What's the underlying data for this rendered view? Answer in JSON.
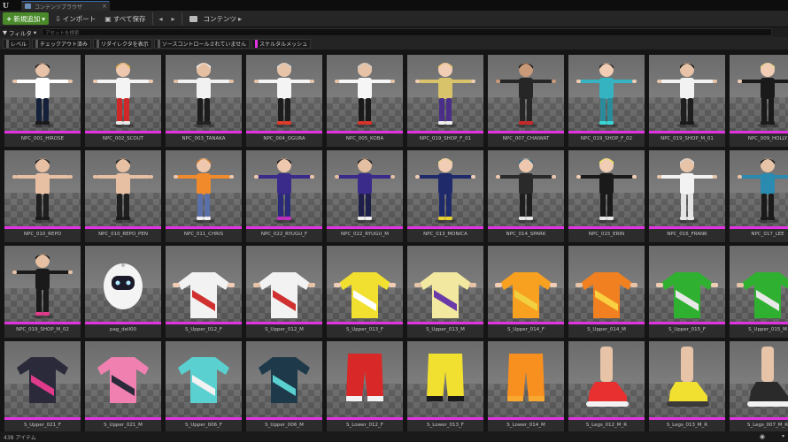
{
  "window": {
    "tab_title": "コンテンツブラウザ"
  },
  "toolbar": {
    "add_new": "新規追加",
    "import": "インポート",
    "save_all": "すべて保存",
    "breadcrumb": "コンテンツ"
  },
  "filter": {
    "filters_label": "フィルタ",
    "search_placeholder": "アセットを検索"
  },
  "chips": [
    {
      "label": "レベル",
      "active": false
    },
    {
      "label": "チェックアウト済み",
      "active": false
    },
    {
      "label": "リダイレクタを表示",
      "active": false
    },
    {
      "label": "ソースコントロールされていません",
      "active": false
    },
    {
      "label": "スケルタルメッシュ",
      "active": true
    }
  ],
  "assets": [
    {
      "name": "NPC_001_HIROSE",
      "kind": "body",
      "top": "#ffffff",
      "bottom": "#15203a",
      "hair": "#1a1a1a",
      "skin": "#e8c3a8",
      "shoes": "#1a1a1a"
    },
    {
      "name": "NPC_002_SCOUT",
      "kind": "body",
      "top": "#f4f4f4",
      "bottom": "#d02828",
      "hair": "#d8a640",
      "skin": "#eec8ae",
      "shoes": "#e8e8e8"
    },
    {
      "name": "NPC_003_TANAKA",
      "kind": "body",
      "top": "#f1f1f1",
      "bottom": "#1c1c1c",
      "hair": "#f2f2f2",
      "skin": "#e4bfa2",
      "shoes": "#222222"
    },
    {
      "name": "NPC_004_OGURA",
      "kind": "body",
      "top": "#f4f4f4",
      "bottom": "#1d1d1d",
      "hair": "#d6d6d6",
      "skin": "#e7c4a7",
      "shoes": "#e03b2a"
    },
    {
      "name": "NPC_005_KOBA",
      "kind": "body",
      "top": "#f6f6f6",
      "bottom": "#1a1a1a",
      "hair": "#cfcfcf",
      "skin": "#e6c3a6",
      "shoes": "#d8322a"
    },
    {
      "name": "NPC_019_SHOP_F_01",
      "kind": "body",
      "top": "#d8c36a",
      "bottom": "#4a2e8a",
      "hair": "#e8c872",
      "skin": "#f0cdb4",
      "shoes": "#eeeeee"
    },
    {
      "name": "NPC_007_CHAIWAT",
      "kind": "body",
      "top": "#262626",
      "bottom": "#262626",
      "hair": "#1a1a1a",
      "skin": "#c99a78",
      "shoes": "#c72828"
    },
    {
      "name": "NPC_019_SHOP_F_02",
      "kind": "body",
      "top": "#35b3c0",
      "bottom": "#2a8c9a",
      "hair": "#2a2a2a",
      "skin": "#f0cdb4",
      "shoes": "#3ad4d4"
    },
    {
      "name": "NPC_019_SHOP_M_01",
      "kind": "body",
      "top": "#f2f2f2",
      "bottom": "#1e1e1e",
      "hair": "#1a1a1a",
      "skin": "#e8c3a8",
      "shoes": "#1a1a1a"
    },
    {
      "name": "NPC_009_HOLLY",
      "kind": "body",
      "top": "#1a1a1a",
      "bottom": "#1a1a1a",
      "hair": "#e8d38a",
      "skin": "#f0cdb4",
      "shoes": "#1a1a1a"
    },
    {
      "name": "NPC_010_REPO",
      "kind": "body",
      "top": "#e7c0a4",
      "bottom": "#1f1f1f",
      "hair": "#1a1a1a",
      "skin": "#e7c0a4",
      "shoes": "#1a1a1a"
    },
    {
      "name": "NPC_010_REPO_PEN",
      "kind": "body",
      "top": "#e7c0a4",
      "bottom": "#1f1f1f",
      "hair": "#1a1a1a",
      "skin": "#e7c0a4",
      "shoes": "#1a1a1a"
    },
    {
      "name": "NPC_011_CHRIS",
      "kind": "body",
      "top": "#f08a2a",
      "bottom": "#5b6fa8",
      "hair": "#d07a2a",
      "skin": "#eec8ae",
      "shoes": "#eeeeee"
    },
    {
      "name": "NPC_022_RYUGU_F",
      "kind": "body",
      "top": "#3a2a8a",
      "bottom": "#2a2a7a",
      "hair": "#1a1a1a",
      "skin": "#eec8ae",
      "shoes": "#c030c0"
    },
    {
      "name": "NPC_022_RYUGU_M",
      "kind": "body",
      "top": "#3a2a8a",
      "bottom": "#1e1e4a",
      "hair": "#1a1a1a",
      "skin": "#e4bfa2",
      "shoes": "#eeeeee"
    },
    {
      "name": "NPC_013_MONICA",
      "kind": "body",
      "top": "#1e2a6a",
      "bottom": "#1e2a6a",
      "hair": "#e8d38a",
      "skin": "#f0cdb4",
      "shoes": "#e8d030"
    },
    {
      "name": "NPC_014_SPARK",
      "kind": "body",
      "top": "#2a2a2a",
      "bottom": "#1e1e1e",
      "hair": "#2a6a8a",
      "skin": "#eec8ae",
      "shoes": "#e8e8e8"
    },
    {
      "name": "NPC_015_ERIN",
      "kind": "body",
      "top": "#1a1a1a",
      "bottom": "#1a1a1a",
      "hair": "#e8e850",
      "skin": "#f0cdb4",
      "shoes": "#e8e8e8"
    },
    {
      "name": "NPC_016_FRANK",
      "kind": "body",
      "top": "#f2f2f2",
      "bottom": "#e4e4e4",
      "hair": "#d8d8d8",
      "skin": "#e7c4a7",
      "shoes": "#e8e8e8"
    },
    {
      "name": "NPC_017_LEE",
      "kind": "body",
      "top": "#2a8ab0",
      "bottom": "#1a1a1a",
      "hair": "#1a1a1a",
      "skin": "#e7c4a7",
      "shoes": "#1a1a1a"
    },
    {
      "name": "NPC_019_SHOP_M_02",
      "kind": "body",
      "top": "#1a1a1a",
      "bottom": "#1a1a1a",
      "hair": "#1a1a1a",
      "skin": "#e7c0a4",
      "shoes": "#e03b8a"
    },
    {
      "name": "pag_dell00",
      "kind": "robot",
      "top": "#f4f4f4",
      "bottom": "#f4f4f4",
      "hair": "#1a1a2a",
      "skin": "#f4f4f4",
      "shoes": "#f4f4f4"
    },
    {
      "name": "S_Upper_012_F",
      "kind": "shirt",
      "top": "#f2f2f2",
      "bottom": "#d03030",
      "hair": "",
      "skin": "#f0cdb4",
      "shoes": ""
    },
    {
      "name": "S_Upper_012_M",
      "kind": "shirt",
      "top": "#f2f2f2",
      "bottom": "#d03030",
      "hair": "",
      "skin": "#e7c4a7",
      "shoes": ""
    },
    {
      "name": "S_Upper_013_F",
      "kind": "shirt",
      "top": "#f2e030",
      "bottom": "#ffffff",
      "hair": "",
      "skin": "#f0cdb4",
      "shoes": ""
    },
    {
      "name": "S_Upper_013_M",
      "kind": "shirt",
      "top": "#f2e8a0",
      "bottom": "#6a3aa8",
      "hair": "",
      "skin": "#e7c4a7",
      "shoes": ""
    },
    {
      "name": "S_Upper_014_F",
      "kind": "shirt",
      "top": "#f8a020",
      "bottom": "#f0d040",
      "hair": "",
      "skin": "#f0cdb4",
      "shoes": ""
    },
    {
      "name": "S_Upper_014_M",
      "kind": "shirt",
      "top": "#f08020",
      "bottom": "#f8d040",
      "hair": "",
      "skin": "#e7c4a7",
      "shoes": ""
    },
    {
      "name": "S_Upper_015_F",
      "kind": "shirt",
      "top": "#30b030",
      "bottom": "#e8e8e8",
      "hair": "",
      "skin": "#f0cdb4",
      "shoes": ""
    },
    {
      "name": "S_Upper_015_M",
      "kind": "shirt",
      "top": "#30b030",
      "bottom": "#e8e8e8",
      "hair": "",
      "skin": "#e7c4a7",
      "shoes": ""
    },
    {
      "name": "S_Upper_021_F",
      "kind": "jersey",
      "top": "#2a2a3a",
      "bottom": "#e03b8a",
      "hair": "",
      "skin": "",
      "shoes": ""
    },
    {
      "name": "S_Upper_021_M",
      "kind": "jersey",
      "top": "#f080b0",
      "bottom": "#2a2a3a",
      "hair": "",
      "skin": "",
      "shoes": ""
    },
    {
      "name": "S_Upper_006_F",
      "kind": "jersey",
      "top": "#5ad0d0",
      "bottom": "#f2f2f2",
      "hair": "",
      "skin": "",
      "shoes": ""
    },
    {
      "name": "S_Upper_006_M",
      "kind": "jersey",
      "top": "#1e3a4a",
      "bottom": "#5ad0d0",
      "hair": "",
      "skin": "",
      "shoes": ""
    },
    {
      "name": "S_Lower_012_F",
      "kind": "shorts",
      "top": "#d82828",
      "bottom": "#f2f2f2",
      "hair": "",
      "skin": "",
      "shoes": ""
    },
    {
      "name": "S_Lower_013_F",
      "kind": "shorts",
      "top": "#f2e030",
      "bottom": "#1a1a1a",
      "hair": "",
      "skin": "",
      "shoes": ""
    },
    {
      "name": "S_Lower_014_M",
      "kind": "shorts",
      "top": "#f89020",
      "bottom": "#f8a830",
      "hair": "",
      "skin": "",
      "shoes": ""
    },
    {
      "name": "S_Legs_012_M_R",
      "kind": "shoe",
      "top": "#e83030",
      "bottom": "#f2f2f2",
      "hair": "",
      "skin": "",
      "shoes": ""
    },
    {
      "name": "S_Legs_013_M_R",
      "kind": "shoe",
      "top": "#f2e030",
      "bottom": "#3a3a3a",
      "hair": "",
      "skin": "",
      "shoes": ""
    },
    {
      "name": "S_Legs_007_M_R",
      "kind": "shoe",
      "top": "#2a2a2a",
      "bottom": "#f2f2f2",
      "hair": "",
      "skin": "",
      "shoes": ""
    }
  ],
  "status": {
    "count": "438 アイテム",
    "view_options": "表示オプション"
  }
}
